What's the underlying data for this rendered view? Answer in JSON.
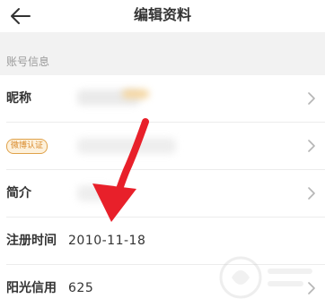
{
  "header": {
    "title": "编辑资料",
    "back_icon": "arrow-left-icon"
  },
  "section": {
    "label": "账号信息"
  },
  "rows": [
    {
      "label": "昵称",
      "value": ""
    },
    {
      "badge": "微博认证",
      "value": ""
    },
    {
      "label": "简介",
      "value": ""
    },
    {
      "label": "注册时间",
      "value": "2010-11-18"
    },
    {
      "label": "阳光信用",
      "value": "625"
    }
  ],
  "colors": {
    "badge_border": "#e0a24a",
    "badge_text": "#d98a2b",
    "arrow": "#e8202a",
    "section_bg": "#f2f2f2"
  }
}
